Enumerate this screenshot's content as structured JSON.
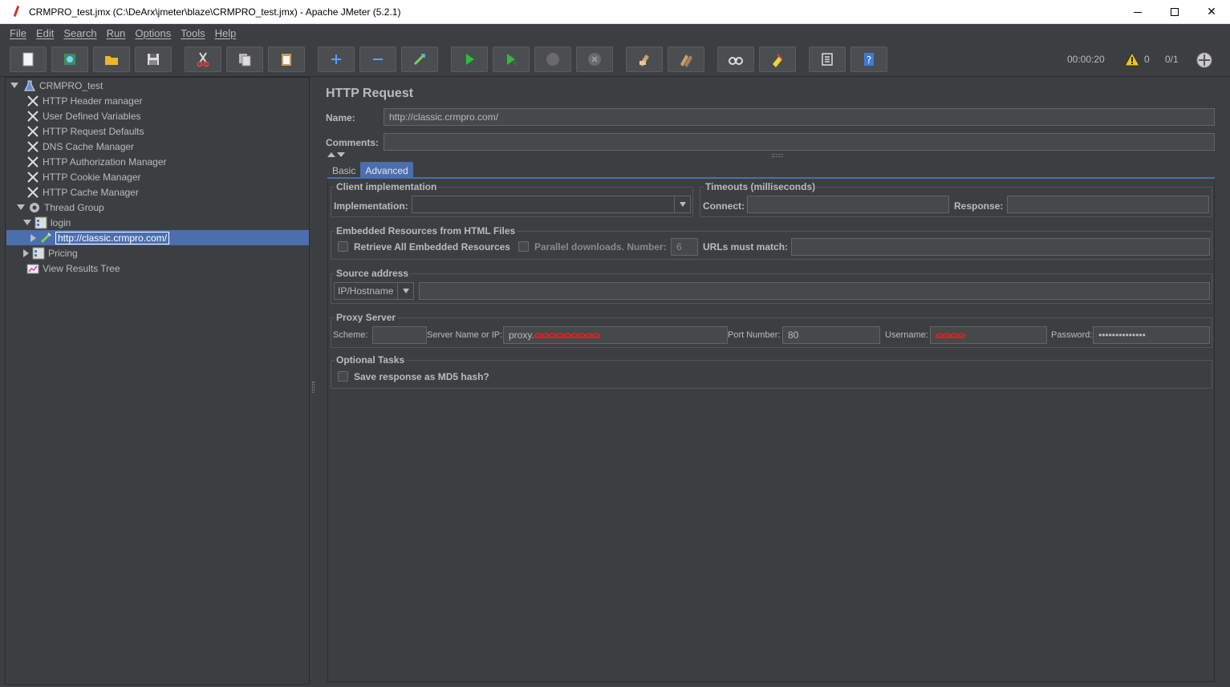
{
  "window": {
    "title": "CRMPRO_test.jmx (C:\\DeArx\\jmeter\\blaze\\CRMPRO_test.jmx) - Apache JMeter (5.2.1)",
    "minimize": "",
    "maximize": "",
    "close": "✕"
  },
  "menu": [
    "File",
    "Edit",
    "Search",
    "Run",
    "Options",
    "Tools",
    "Help"
  ],
  "toolbar": {
    "icons": [
      "new-icon",
      "templates-icon",
      "open-icon",
      "save-icon",
      "cut-icon",
      "copy-icon",
      "paste-icon",
      "expand-icon",
      "collapse-icon",
      "toggle-icon",
      "start-icon",
      "start-no-pauses-icon",
      "stop-icon",
      "shutdown-icon",
      "clear-icon",
      "clear-all-icon",
      "search-icon",
      "reset-search-icon",
      "function-helper-icon",
      "help-icon"
    ],
    "timer": "00:00:20",
    "warnings": "0",
    "threads": "0/1"
  },
  "tree": {
    "root": "CRMPRO_test",
    "items": [
      "HTTP Header manager",
      "User Defined Variables",
      "HTTP Request Defaults",
      "DNS Cache Manager",
      "HTTP Authorization Manager",
      "HTTP Cookie Manager",
      "HTTP Cache Manager"
    ],
    "thread_group": "Thread Group",
    "login": "login",
    "selected": "http://classic.crmpro.com/",
    "pricing": "Pricing",
    "view_results": "View Results Tree"
  },
  "panel": {
    "title": "HTTP Request",
    "name_label": "Name:",
    "name_value": "http://classic.crmpro.com/",
    "comments_label": "Comments:",
    "comments_value": "",
    "tabs": [
      "Basic",
      "Advanced"
    ],
    "active_tab": "Advanced",
    "client_impl": {
      "title": "Client implementation",
      "implementation_label": "Implementation:",
      "implementation_value": ""
    },
    "timeouts": {
      "title": "Timeouts (milliseconds)",
      "connect_label": "Connect:",
      "connect_value": "",
      "response_label": "Response:",
      "response_value": ""
    },
    "embedded": {
      "title": "Embedded Resources from HTML Files",
      "retrieve_label": "Retrieve All Embedded Resources",
      "parallel_label": "Parallel downloads. Number:",
      "parallel_value": "6",
      "urls_label": "URLs must match:",
      "urls_value": ""
    },
    "source": {
      "title": "Source address",
      "type_value": "IP/Hostname",
      "address_value": ""
    },
    "proxy": {
      "title": "Proxy Server",
      "scheme_label": "Scheme:",
      "scheme_value": "",
      "server_label": "Server Name or IP:",
      "server_prefix": "proxy.",
      "server_redacted": "scribbled",
      "port_label": "Port Number:",
      "port_value": "80",
      "username_label": "Username:",
      "username_redacted": "scribbled",
      "password_label": "Password:",
      "password_value": "••••••••••••••"
    },
    "optional": {
      "title": "Optional Tasks",
      "md5_label": "Save response as MD5 hash?"
    }
  },
  "colors": {
    "background": "#3c3f41",
    "selection": "#4b6eaf",
    "field": "#45494a",
    "text": "#bbbbbb",
    "redaction": "#ff1a1a"
  }
}
